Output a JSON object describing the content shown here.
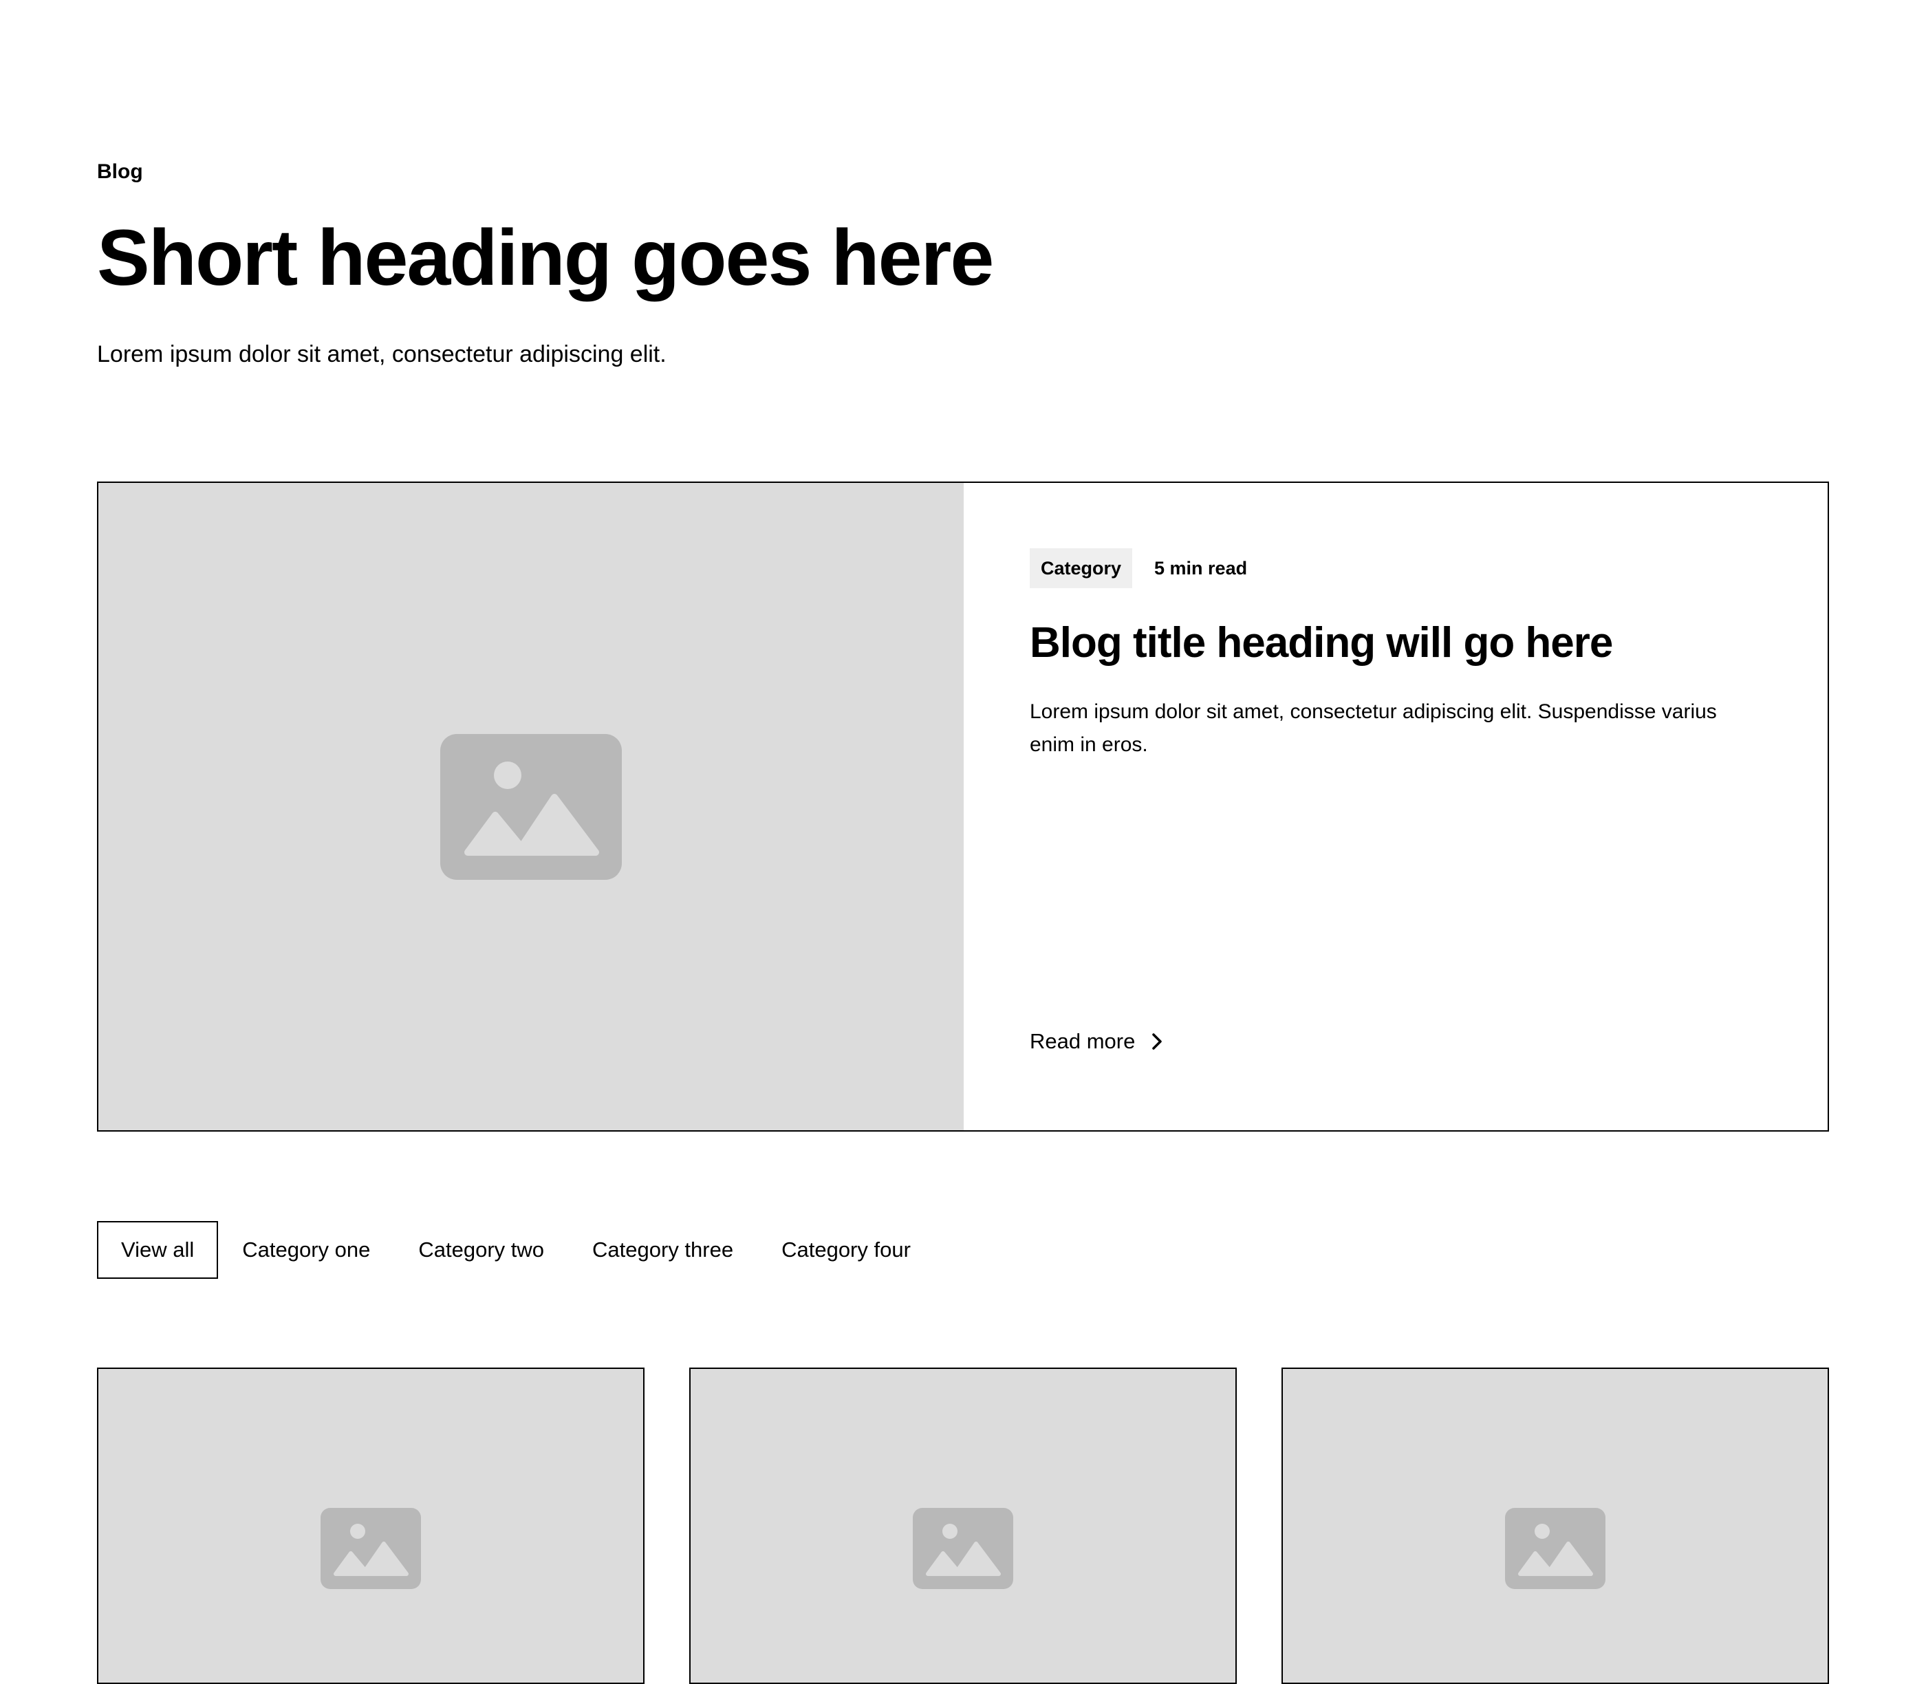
{
  "header": {
    "eyebrow": "Blog",
    "title": "Short heading goes here",
    "subtitle": "Lorem ipsum dolor sit amet, consectetur adipiscing elit."
  },
  "featured": {
    "image_icon": "image-placeholder-icon",
    "category": "Category",
    "read_time": "5 min read",
    "title": "Blog title heading will go here",
    "excerpt": "Lorem ipsum dolor sit amet, consectetur adipiscing elit. Suspendisse varius enim in eros.",
    "read_more": "Read more",
    "read_more_icon": "chevron-right-icon"
  },
  "tabs": [
    {
      "label": "View all",
      "active": true
    },
    {
      "label": "Category one",
      "active": false
    },
    {
      "label": "Category two",
      "active": false
    },
    {
      "label": "Category three",
      "active": false
    },
    {
      "label": "Category four",
      "active": false
    }
  ],
  "cards": [
    {
      "image_icon": "image-placeholder-icon"
    },
    {
      "image_icon": "image-placeholder-icon"
    },
    {
      "image_icon": "image-placeholder-icon"
    }
  ],
  "colors": {
    "placeholder_bg": "#dcdcdc",
    "placeholder_icon": "#b8b8b8",
    "tag_bg": "#efefef",
    "border": "#000000"
  }
}
